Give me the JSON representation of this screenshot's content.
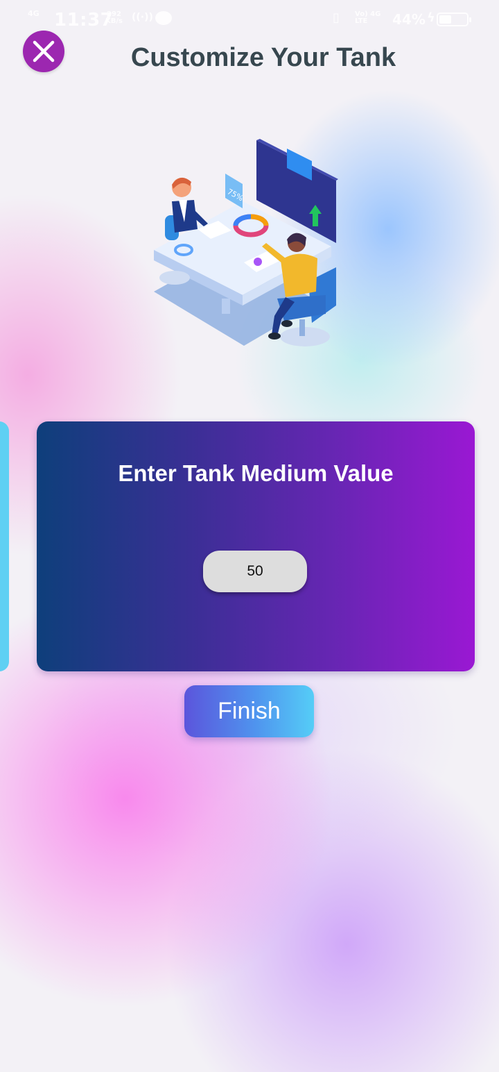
{
  "status_bar": {
    "network": "4G",
    "time": "11:37",
    "speed_value": "292",
    "speed_unit": "KB/s",
    "carrier_top": "Vo) 4G",
    "carrier_bottom": "LTE",
    "battery_percent": "44%",
    "battery_level": 0.44,
    "icons": [
      "signal-icon",
      "hotspot-icon",
      "chat-icon",
      "vibrate-icon",
      "charging-icon",
      "battery-icon"
    ]
  },
  "header": {
    "title": "Customize Your Tank",
    "close_icon": "close-icon"
  },
  "illustration": {
    "icon": "business-meeting-illustration",
    "badge_text": "75%"
  },
  "card": {
    "title": "Enter Tank Medium Value",
    "input_value": "50"
  },
  "actions": {
    "finish_label": "Finish"
  },
  "colors": {
    "close_button": "#9c27b0",
    "title_text": "#37474f",
    "card_gradient_start": "#0e3f7b",
    "card_gradient_end": "#9a18d3",
    "finish_gradient_start": "#5b55dc",
    "finish_gradient_end": "#55cdf7",
    "peek_card": "#5fd0f3"
  }
}
